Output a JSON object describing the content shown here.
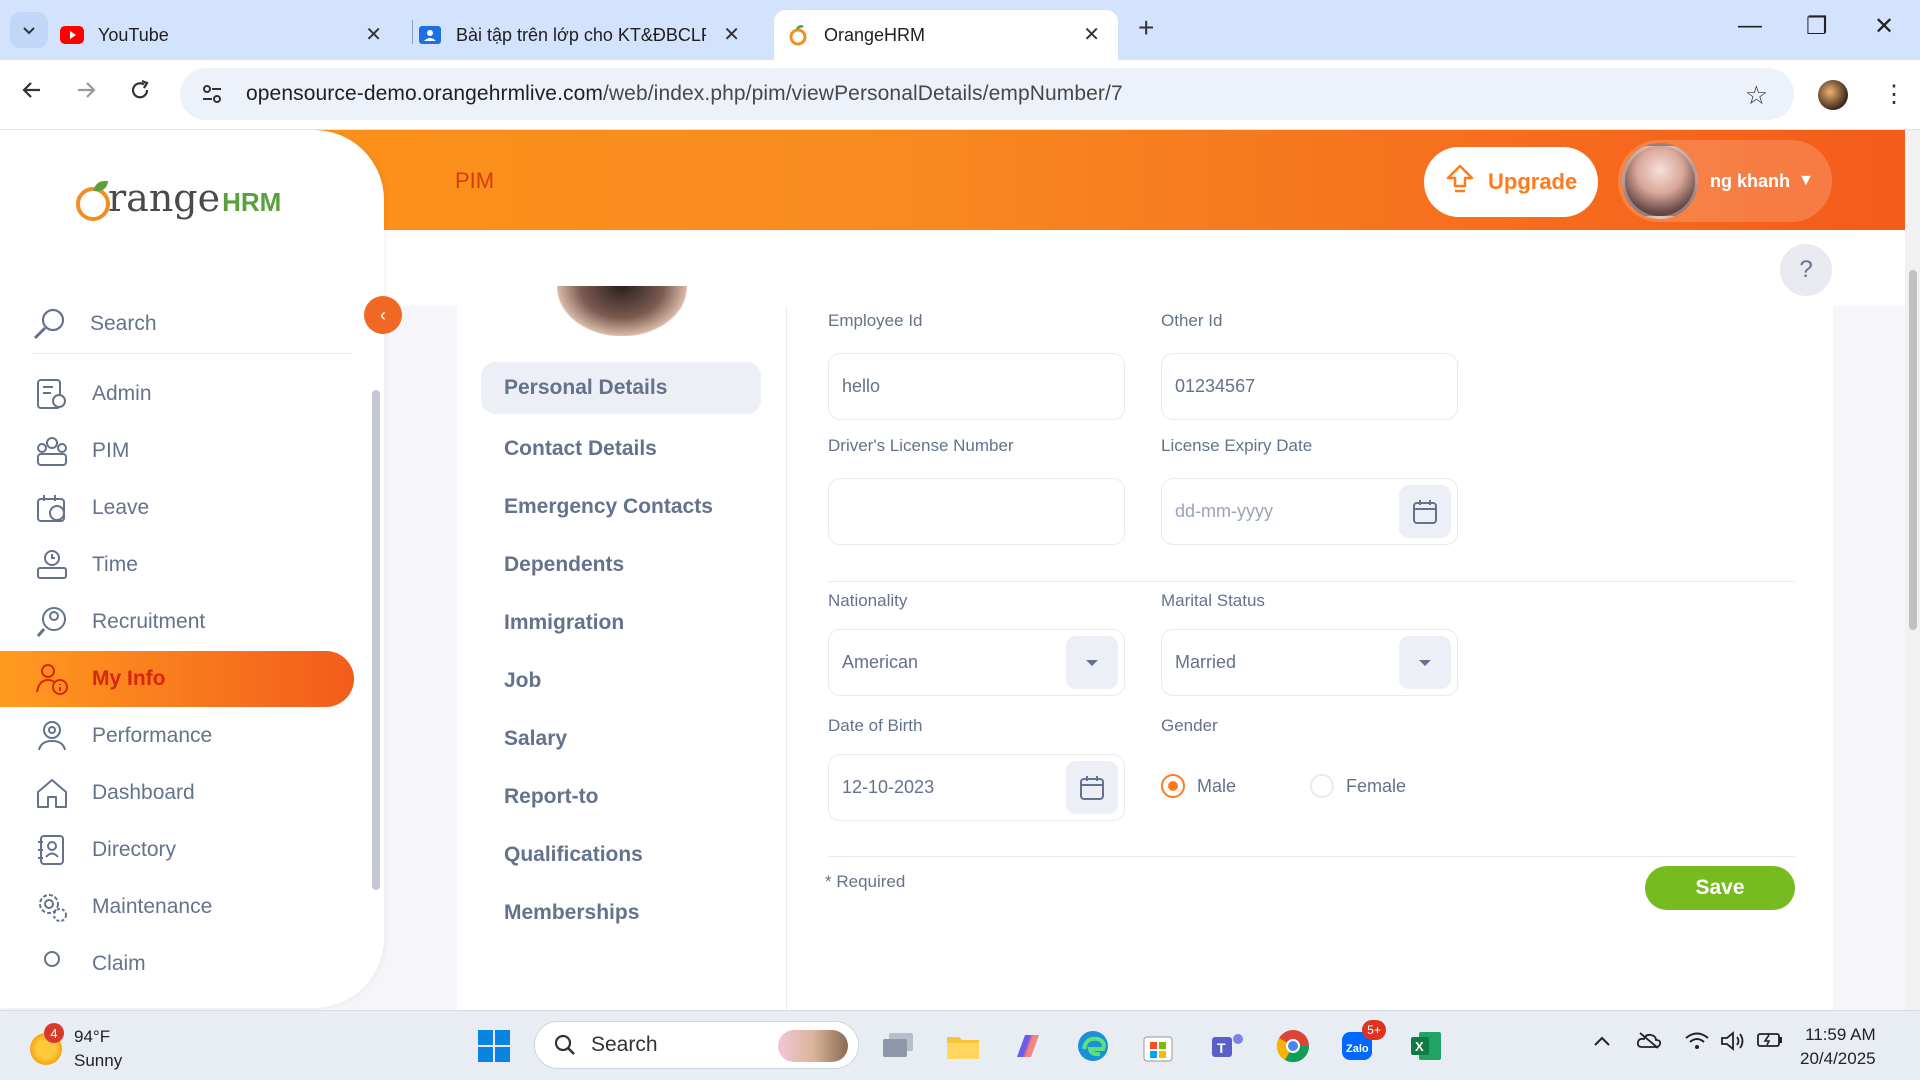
{
  "browser": {
    "tabs": [
      {
        "title": "YouTube",
        "icon": "youtube-icon"
      },
      {
        "title": "Bài tập trên lớp cho KT&ĐBCLP",
        "icon": "classroom-icon"
      },
      {
        "title": "OrangeHRM",
        "icon": "orangehrm-icon",
        "active": true
      }
    ],
    "url_host": "opensource-demo.orangehrmlive.com",
    "url_path": "/web/index.php/pim/viewPersonalDetails/empNumber/7"
  },
  "header": {
    "module": "PIM",
    "upgrade_label": "Upgrade",
    "user_name": "ng khanh",
    "help_label": "?"
  },
  "sidebar": {
    "search_label": "Search",
    "items": [
      {
        "label": "Admin",
        "icon": "admin-icon"
      },
      {
        "label": "PIM",
        "icon": "pim-icon"
      },
      {
        "label": "Leave",
        "icon": "leave-icon"
      },
      {
        "label": "Time",
        "icon": "time-icon"
      },
      {
        "label": "Recruitment",
        "icon": "recruitment-icon"
      },
      {
        "label": "My Info",
        "icon": "my-info-icon",
        "active": true
      },
      {
        "label": "Performance",
        "icon": "performance-icon"
      },
      {
        "label": "Dashboard",
        "icon": "dashboard-icon"
      },
      {
        "label": "Directory",
        "icon": "directory-icon"
      },
      {
        "label": "Maintenance",
        "icon": "maintenance-icon"
      },
      {
        "label": "Claim",
        "icon": "claim-icon"
      }
    ]
  },
  "tabs": [
    "Personal Details",
    "Contact Details",
    "Emergency Contacts",
    "Dependents",
    "Immigration",
    "Job",
    "Salary",
    "Report-to",
    "Qualifications",
    "Memberships"
  ],
  "form": {
    "employee_id_label": "Employee Id",
    "employee_id_value": "hello",
    "other_id_label": "Other Id",
    "other_id_value": "01234567",
    "license_label": "Driver's License Number",
    "license_value": "",
    "license_expiry_label": "License Expiry Date",
    "license_expiry_placeholder": "dd-mm-yyyy",
    "nationality_label": "Nationality",
    "nationality_value": "American",
    "marital_label": "Marital Status",
    "marital_value": "Married",
    "dob_label": "Date of Birth",
    "dob_value": "12-10-2023",
    "gender_label": "Gender",
    "gender_options": [
      "Male",
      "Female"
    ],
    "gender_selected": "Male",
    "required_note": "* Required",
    "save_label": "Save"
  },
  "taskbar": {
    "weather_temp": "94°F",
    "weather_desc": "Sunny",
    "weather_badge": "4",
    "search_label": "Search",
    "zalo_badge": "5+",
    "time": "11:59 AM",
    "date": "20/4/2025"
  },
  "colors": {
    "brand_orange": "#ff7b1d",
    "save_green": "#76bc21",
    "text_gray": "#64728c"
  }
}
